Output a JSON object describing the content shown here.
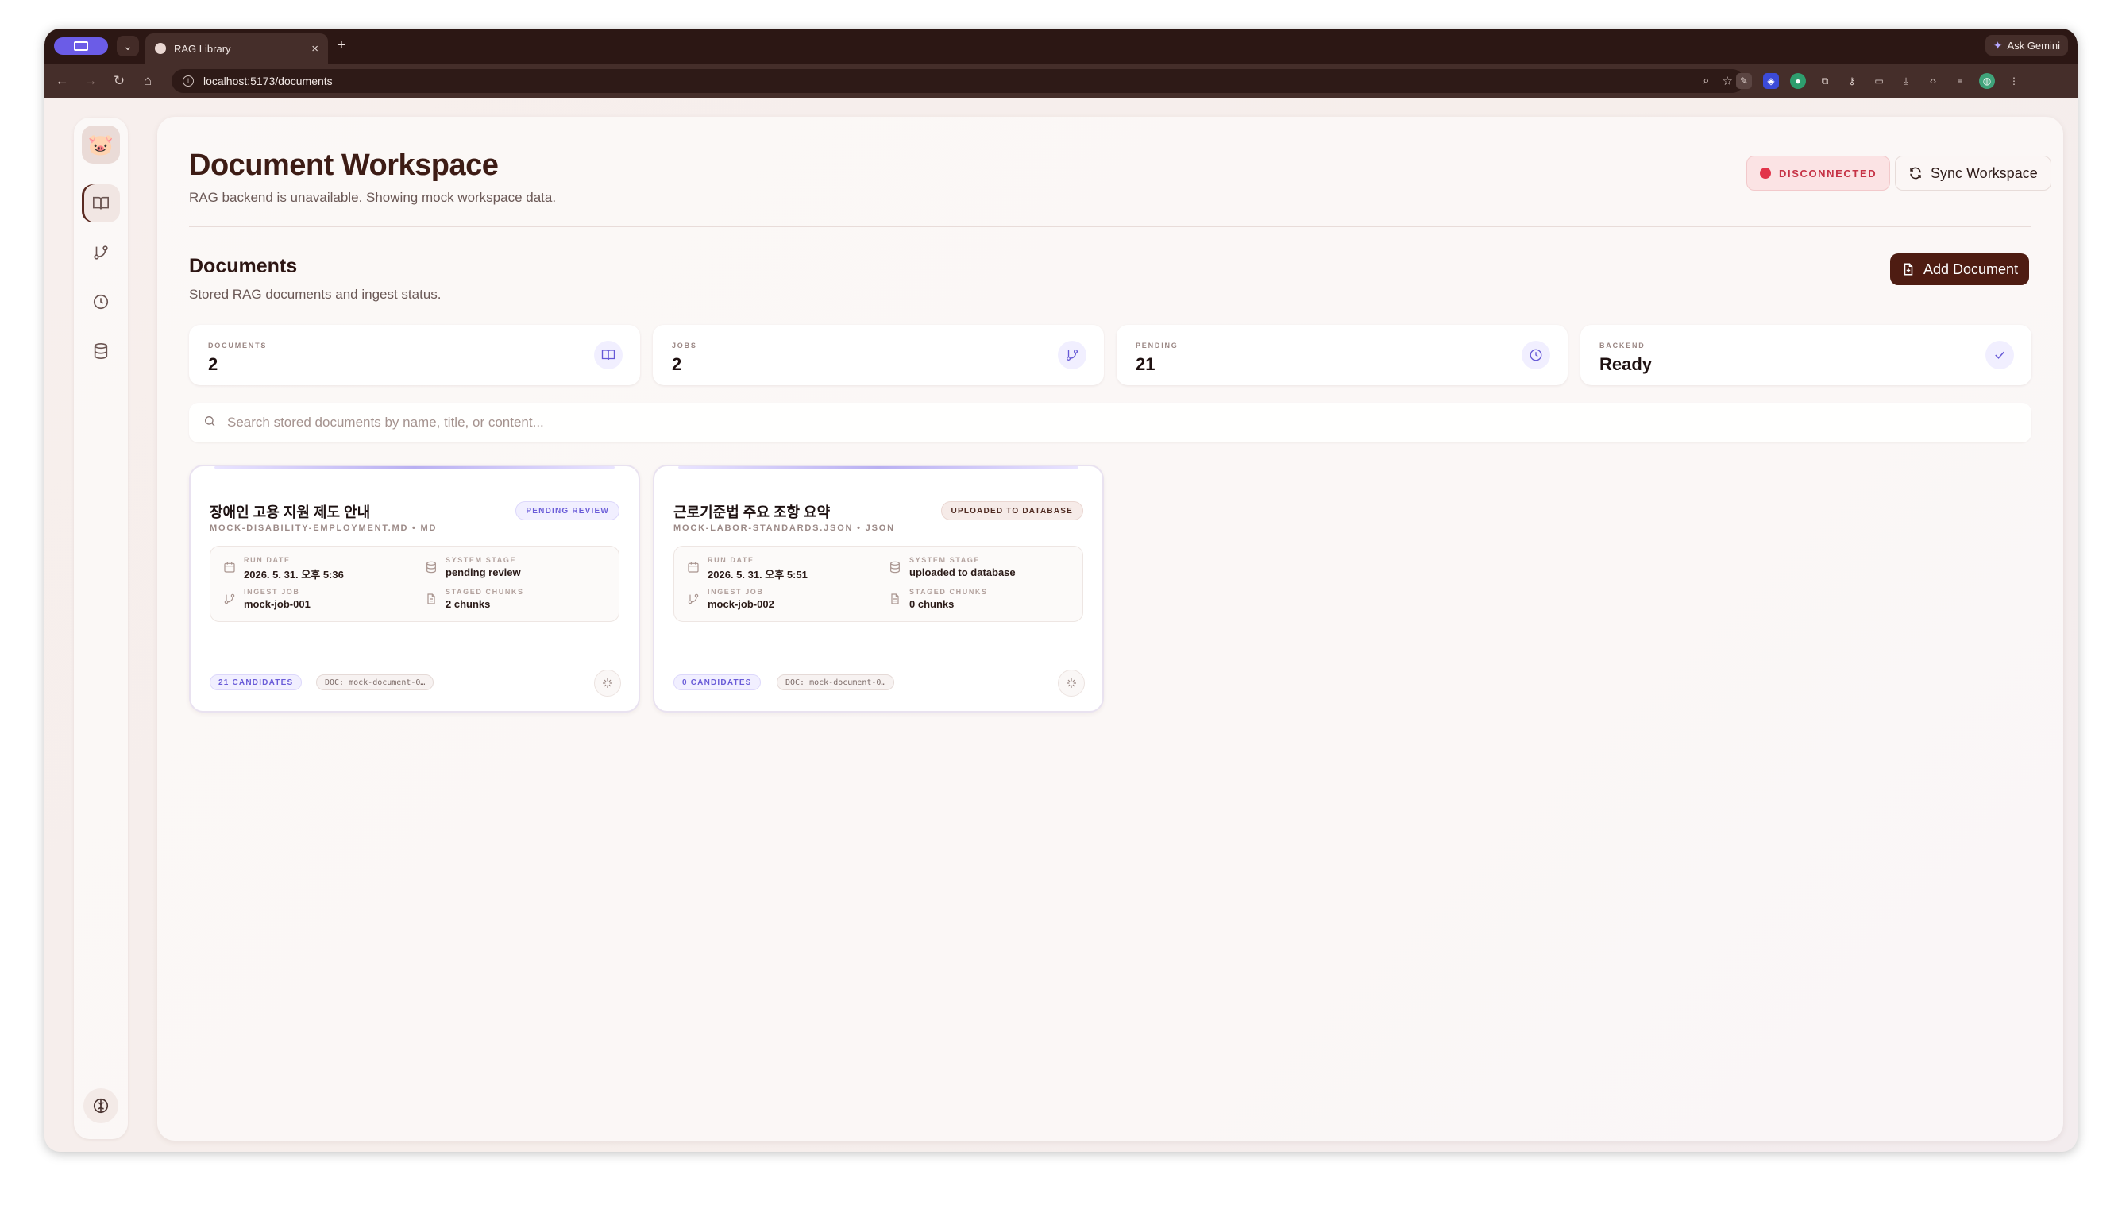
{
  "browser": {
    "tab_title": "RAG Library",
    "url": "localhost:5173/documents",
    "ask_gemini": "Ask Gemini"
  },
  "header": {
    "title": "Document Workspace",
    "subtitle": "RAG backend is unavailable. Showing mock workspace data.",
    "status": "DISCONNECTED",
    "sync_label": "Sync Workspace"
  },
  "section": {
    "title": "Documents",
    "subtitle": "Stored RAG documents and ingest status.",
    "add_label": "Add Document"
  },
  "stats": [
    {
      "label": "DOCUMENTS",
      "value": "2",
      "icon": "book-open-icon"
    },
    {
      "label": "JOBS",
      "value": "2",
      "icon": "git-branch-icon"
    },
    {
      "label": "PENDING",
      "value": "21",
      "icon": "clock-icon"
    },
    {
      "label": "BACKEND",
      "value": "Ready",
      "icon": "check-icon"
    }
  ],
  "search": {
    "placeholder": "Search stored documents by name, title, or content..."
  },
  "documents": [
    {
      "title": "장애인 고용 지원 제도 안내",
      "meta": "MOCK-DISABILITY-EMPLOYMENT.MD • MD",
      "badge": "PENDING REVIEW",
      "run_date_label": "RUN DATE",
      "run_date": "2026. 5. 31. 오후 5:36",
      "stage_label": "SYSTEM STAGE",
      "stage": "pending review",
      "job_label": "INGEST JOB",
      "job": "mock-job-001",
      "chunks_label": "STAGED CHUNKS",
      "chunks": "2 chunks",
      "candidates": "21 CANDIDATES",
      "doc_chip": "DOC: mock-document-0…"
    },
    {
      "title": "근로기준법 주요 조항 요약",
      "meta": "MOCK-LABOR-STANDARDS.JSON • JSON",
      "badge": "UPLOADED TO DATABASE",
      "run_date_label": "RUN DATE",
      "run_date": "2026. 5. 31. 오후 5:51",
      "stage_label": "SYSTEM STAGE",
      "stage": "uploaded to database",
      "job_label": "INGEST JOB",
      "job": "mock-job-002",
      "chunks_label": "STAGED CHUNKS",
      "chunks": "0 chunks",
      "candidates": "0 CANDIDATES",
      "doc_chip": "DOC: mock-document-0…"
    }
  ],
  "colors": {
    "accent": "#4e1c12",
    "violet": "#6a5cd8",
    "danger": "#e2344a"
  }
}
